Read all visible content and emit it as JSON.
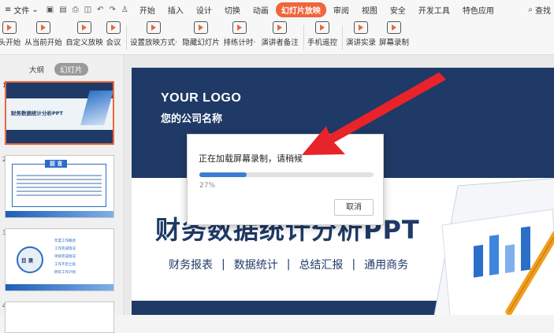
{
  "menubar": {
    "file_label": "文件",
    "tabs": [
      "开始",
      "插入",
      "设计",
      "切换",
      "动画",
      "幻灯片放映",
      "审阅",
      "视图",
      "安全",
      "开发工具",
      "特色应用"
    ],
    "active_tab": "幻灯片放映",
    "search_label": "查找"
  },
  "ribbon": {
    "buttons": [
      "头开始",
      "从当前开始",
      "自定义放映",
      "会议",
      "设置放映方式·",
      "隐藏幻灯片",
      "排练计时·",
      "演讲者备注",
      "手机遥控",
      "演讲实录",
      "屏幕录制"
    ]
  },
  "left_pane": {
    "tabs": [
      "大纲",
      "幻灯片"
    ],
    "active_tab": "幻灯片",
    "slides": [
      {
        "num": "1",
        "title": "财务数据统计分析PPT"
      },
      {
        "num": "2",
        "title": "前 言"
      },
      {
        "num": "3",
        "title": "目 录",
        "items": [
          "年度工作概述",
          "工作完成情况",
          "项目完成情况",
          "工作不足之处",
          "明年工作计划"
        ]
      },
      {
        "num": "4",
        "title": ""
      }
    ]
  },
  "slide": {
    "logo": "YOUR LOGO",
    "company": "您的公司名称",
    "title": "财务数据统计分析PPT",
    "subtitles": [
      "财务报表",
      "数据统计",
      "总结汇报",
      "通用商务"
    ]
  },
  "dialog": {
    "message": "正在加载屏幕录制，请稍候",
    "progress": 0.27,
    "percent_text": "27%",
    "cancel_label": "取消"
  },
  "colors": {
    "accent": "#f0663c",
    "slide_navy": "#1f3a66",
    "progress": "#3b7ed5",
    "arrow": "#e8232a"
  }
}
